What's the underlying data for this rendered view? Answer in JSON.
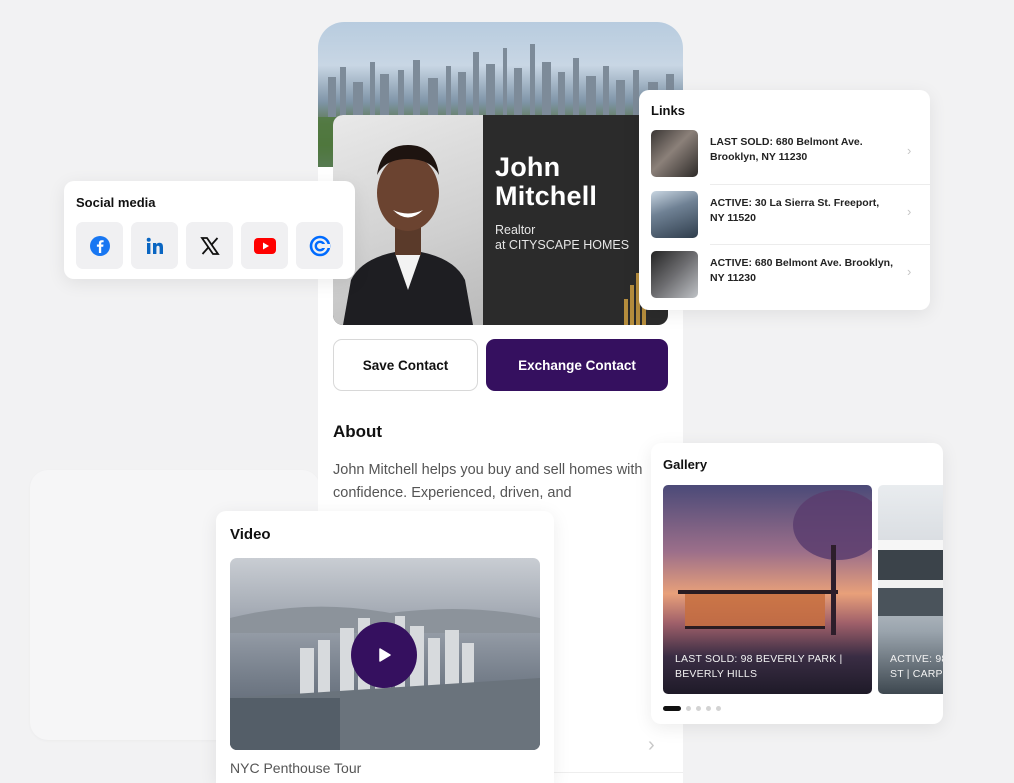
{
  "profile": {
    "name": "John\nMitchell",
    "role": "Realtor",
    "company": "at CITYSCAPE HOMES"
  },
  "actions": {
    "save_label": "Save Contact",
    "exchange_label": "Exchange Contact"
  },
  "about": {
    "title": "About",
    "text": "John Mitchell helps you buy and sell homes with confidence. Experienced, driven, and"
  },
  "social": {
    "title": "Social media",
    "items": [
      {
        "name": "facebook-icon",
        "color": "#1877f2"
      },
      {
        "name": "linkedin-icon",
        "color": "#0a66c2"
      },
      {
        "name": "x-icon",
        "color": "#111111"
      },
      {
        "name": "youtube-icon",
        "color": "#ff0000"
      },
      {
        "name": "calendly-icon",
        "color": "#006bff"
      }
    ]
  },
  "links": {
    "title": "Links",
    "items": [
      {
        "label": "LAST SOLD: 680 Belmont Ave. Brooklyn, NY 11230"
      },
      {
        "label": "ACTIVE: 30 La Sierra St. Freeport, NY 11520"
      },
      {
        "label": "ACTIVE: 680 Belmont Ave. Brooklyn, NY 11230"
      }
    ]
  },
  "gallery": {
    "title": "Gallery",
    "items": [
      {
        "caption": "LAST SOLD: 98 BEVERLY PARK | BEVERLY HILLS"
      },
      {
        "caption": "ACTIVE: 98 ST | CARP"
      }
    ]
  },
  "video": {
    "title": "Video",
    "caption": "NYC Penthouse Tour"
  },
  "colors": {
    "brand": "#35105f",
    "background": "#f2f2f3"
  }
}
